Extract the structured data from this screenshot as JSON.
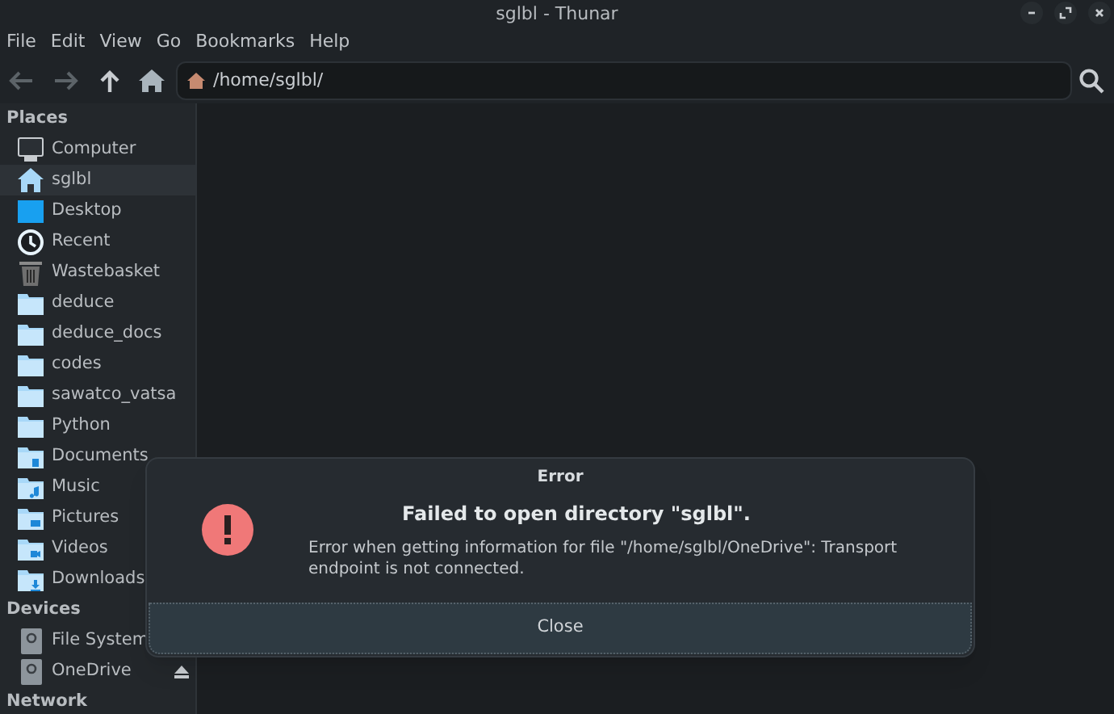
{
  "window": {
    "title": "sglbl - Thunar"
  },
  "menu": [
    "File",
    "Edit",
    "View",
    "Go",
    "Bookmarks",
    "Help"
  ],
  "toolbar": {
    "back_disabled": true,
    "forward_disabled": true
  },
  "location": {
    "value": "/home/sglbl/"
  },
  "sidebar": {
    "sections": [
      {
        "title": "Places",
        "items": [
          {
            "label": "Computer",
            "kind": "computer",
            "selected": false
          },
          {
            "label": "sglbl",
            "kind": "home",
            "selected": true
          },
          {
            "label": "Desktop",
            "kind": "desktop",
            "selected": false
          },
          {
            "label": "Recent",
            "kind": "recent",
            "selected": false
          },
          {
            "label": "Wastebasket",
            "kind": "trash",
            "selected": false
          },
          {
            "label": "deduce",
            "kind": "folder",
            "selected": false
          },
          {
            "label": "deduce_docs",
            "kind": "folder",
            "selected": false
          },
          {
            "label": "codes",
            "kind": "folder",
            "selected": false
          },
          {
            "label": "sawatco_vatsa",
            "kind": "folder",
            "selected": false
          },
          {
            "label": "Python",
            "kind": "folder",
            "selected": false
          },
          {
            "label": "Documents",
            "kind": "documents",
            "selected": false
          },
          {
            "label": "Music",
            "kind": "music",
            "selected": false
          },
          {
            "label": "Pictures",
            "kind": "pictures",
            "selected": false
          },
          {
            "label": "Videos",
            "kind": "videos",
            "selected": false
          },
          {
            "label": "Downloads",
            "kind": "downloads",
            "selected": false
          }
        ]
      },
      {
        "title": "Devices",
        "items": [
          {
            "label": "File System",
            "kind": "drive",
            "selected": false
          },
          {
            "label": "OneDrive",
            "kind": "drive",
            "selected": false,
            "ejectable": true
          }
        ]
      },
      {
        "title": "Network"
      }
    ]
  },
  "dialog": {
    "title": "Error",
    "heading": "Failed to open directory \"sglbl\".",
    "message": "Error when getting information for file \"/home/sglbl/OneDrive\": Transport endpoint is not connected.",
    "button": "Close"
  }
}
